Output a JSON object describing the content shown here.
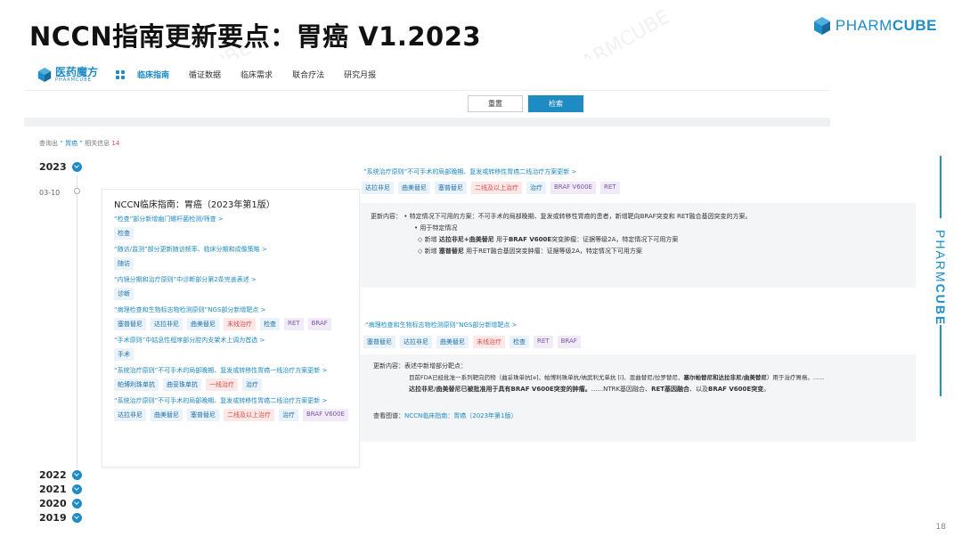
{
  "slide": {
    "title": "NCCN指南更新要点：胃癌 V1.2023",
    "brand_light": "PHARM",
    "brand_bold": "CUBE",
    "page_number": "18"
  },
  "app": {
    "logo_text": "医药魔方",
    "logo_sub": "PHARMCUBE",
    "nav": [
      "临床指南",
      "循证数据",
      "临床需求",
      "联合疗法",
      "研究月报"
    ],
    "reset_label": "重置",
    "search_label": "检索",
    "query_prefix": "查询出",
    "query_keyword": "“ 胃癌 ”",
    "query_mid": "相关信息",
    "query_count": "14"
  },
  "timeline": {
    "top_year": "2023",
    "date": "03-10",
    "older_years": [
      "2022",
      "2021",
      "2020",
      "2019"
    ]
  },
  "left_card": {
    "title": "NCCN临床指南：胃癌（2023年第1版）",
    "entries": [
      {
        "link": "“检查”部分新增幽门螺杆菌检测/筛查  >",
        "tags": [
          {
            "t": "检查",
            "c": ""
          }
        ]
      },
      {
        "link": "“随访/监测”部分更新随访频率、临床分期和成像策略  >",
        "tags": [
          {
            "t": "随访",
            "c": ""
          }
        ]
      },
      {
        "link": "“内镜分期和治疗原则”中诊断部分第2条完善表述  >",
        "tags": [
          {
            "t": "诊断",
            "c": ""
          }
        ]
      },
      {
        "link": "“病理检查和生物标志物检测原则”NGS部分新增靶点  >",
        "tags": [
          {
            "t": "塞普替尼",
            "c": ""
          },
          {
            "t": "达拉非尼",
            "c": ""
          },
          {
            "t": "曲美替尼",
            "c": ""
          },
          {
            "t": "末线治疗",
            "c": "red"
          },
          {
            "t": "检查",
            "c": ""
          },
          {
            "t": "RET",
            "c": "purple"
          },
          {
            "t": "BRAF",
            "c": "purple"
          }
        ]
      },
      {
        "link": "“手术原则”中姑息性程序部分腔内支架术上调为首选  >",
        "tags": [
          {
            "t": "手术",
            "c": ""
          }
        ]
      },
      {
        "link": "“系统治疗原则”不可手术的局部晚期、复发或转移性胃癌一线治疗方案更新  >",
        "tags": [
          {
            "t": "帕博利珠单抗",
            "c": ""
          },
          {
            "t": "曲妥珠单抗",
            "c": ""
          },
          {
            "t": "一线治疗",
            "c": "red"
          },
          {
            "t": "治疗",
            "c": ""
          }
        ]
      },
      {
        "link": "“系统治疗原则”不可手术的局部晚期、复发或转移性胃癌二线治疗方案更新  >",
        "tags": [
          {
            "t": "达拉非尼",
            "c": ""
          },
          {
            "t": "曲美替尼",
            "c": ""
          },
          {
            "t": "塞普替尼",
            "c": ""
          },
          {
            "t": "二线及以上治疗",
            "c": "red"
          },
          {
            "t": "治疗",
            "c": ""
          },
          {
            "t": "BRAF V600E",
            "c": "purple"
          }
        ]
      }
    ]
  },
  "right_top": {
    "link": "“系统治疗原则”不可手术的局部晚期、复发或转移性胃癌二线治疗方案更新  >",
    "tags": [
      {
        "t": "达拉非尼",
        "c": ""
      },
      {
        "t": "曲美替尼",
        "c": ""
      },
      {
        "t": "塞普替尼",
        "c": ""
      },
      {
        "t": "二线及以上治疗",
        "c": "red"
      },
      {
        "t": "治疗",
        "c": ""
      },
      {
        "t": "BRAF V600E",
        "c": "purple"
      },
      {
        "t": "RET",
        "c": "purple"
      }
    ],
    "line1": "更新内容： •  特定情况下可用的方案：不可手术的局部晚期、复发或转移性胃癌的患者，新增靶向BRAF突变和 RET融合基因突变的方案。",
    "line2": "•  用于特定情况",
    "line3a": "◇ 新增 ",
    "line3b": "达拉非尼+曲美替尼",
    "line3c": " 用于",
    "line3d": "BRAF V600E",
    "line3e": "突变肿瘤：证据等级2A，特定情况下可用方案",
    "line4a": "◇ 新增 ",
    "line4b": "塞普替尼",
    "line4c": " 用于RET融合基因突变肿瘤：证据等级2A，特定情况下可用方案"
  },
  "right_bottom": {
    "link": "“病理检查和生物标志物检测原则”NGS部分新增靶点  >",
    "tags": [
      {
        "t": "塞普替尼",
        "c": ""
      },
      {
        "t": "达拉非尼",
        "c": ""
      },
      {
        "t": "曲美替尼",
        "c": ""
      },
      {
        "t": "末线治疗",
        "c": "red"
      },
      {
        "t": "检查",
        "c": ""
      },
      {
        "t": "RET",
        "c": "purple"
      },
      {
        "t": "BRAF",
        "c": "purple"
      }
    ],
    "line1": "更新内容：表述中新增部分靶点：",
    "line2a": "目前FDA已经批准一系列靶向药物（曲妥珠单抗[e]、帕博利珠单抗/纳武利尤单抗 [i]、恩曲替尼/拉罗替尼、",
    "line2b": "塞尔帕替尼和达拉非尼/曲美替尼",
    "line2c": "）用于治疗胃癌。......",
    "line3a": "达拉非尼/曲美替尼已被批准用于具有BRAF V600E突变的肿瘤。",
    "line3b": "......NTRK基因融合、",
    "line3c": "RET基因融合",
    "line3d": "、以及",
    "line3e": "BRAF V600E突变",
    "line3f": "。",
    "view_label": "查看图谱：",
    "view_link": "NCCN临床指南：胃癌（2023年第1版）"
  }
}
